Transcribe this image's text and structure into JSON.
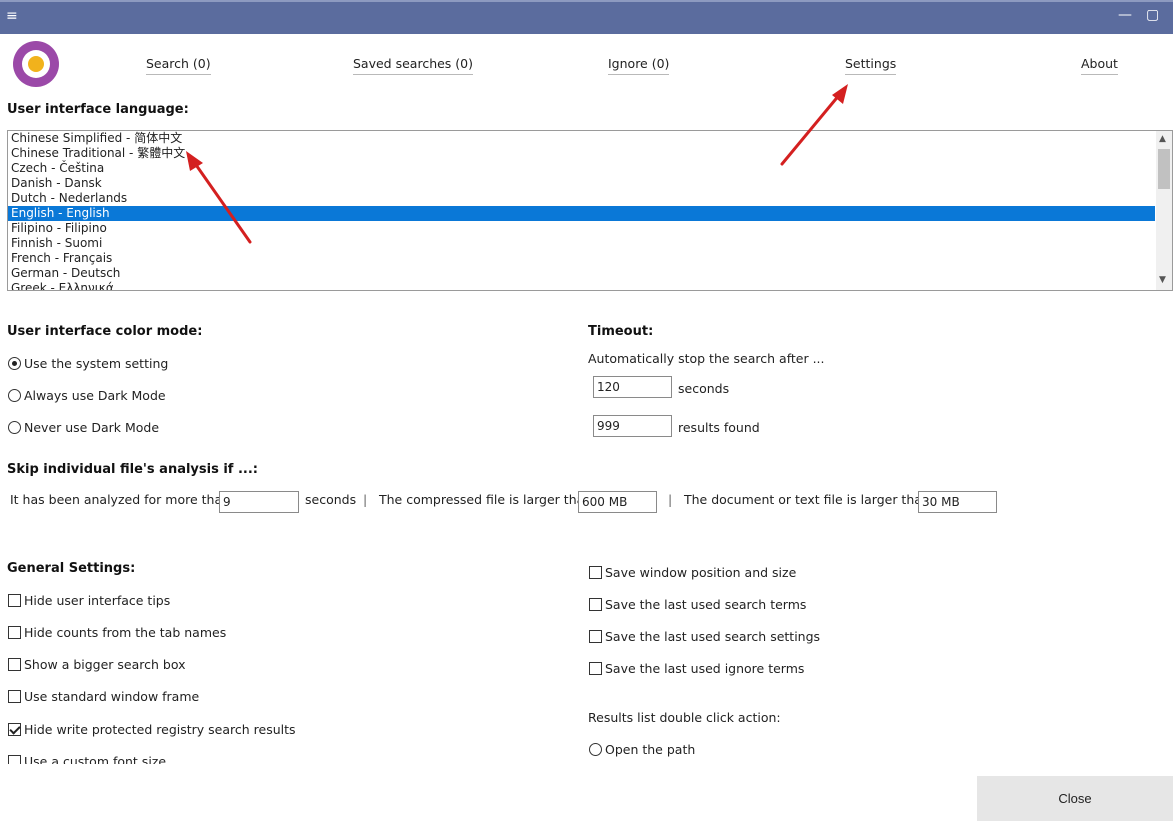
{
  "titlebar": {
    "menu_icon": "hamburger-icon",
    "maximize_icon": "maximize-icon",
    "close_icon": "close-icon"
  },
  "tabs": [
    {
      "label": "Search (0)"
    },
    {
      "label": "Saved searches (0)"
    },
    {
      "label": "Ignore (0)"
    },
    {
      "label": "Settings"
    },
    {
      "label": "About"
    }
  ],
  "language": {
    "heading": "User interface language:",
    "items": [
      "Chinese Simplified - 简体中文",
      "Chinese Traditional - 繁體中文",
      "Czech - Čeština",
      "Danish - Dansk",
      "Dutch - Nederlands",
      "English - English",
      "Filipino - Filipino",
      "Finnish - Suomi",
      "French - Français",
      "German - Deutsch",
      "Greek - Ελληνικά"
    ],
    "selected": "English - English"
  },
  "color_mode": {
    "heading": "User interface color mode:",
    "options": [
      "Use the system setting",
      "Always use Dark Mode",
      "Never use Dark Mode"
    ],
    "selected": "Use the system setting"
  },
  "timeout": {
    "heading": "Timeout:",
    "description": "Automatically stop the search after ...",
    "seconds_value": "120",
    "seconds_label": "seconds",
    "results_value": "999",
    "results_label": "results found"
  },
  "skip": {
    "heading": "Skip individual file's analysis if ...:",
    "analyzed_label": "It has been analyzed for more than",
    "analyzed_value": "9",
    "analyzed_unit": "seconds",
    "separator": "|",
    "compressed_label": "The compressed file is larger than",
    "compressed_value": "600 MB",
    "document_label": "The document or text file is larger than",
    "document_value": "30 MB"
  },
  "general": {
    "heading": "General Settings:",
    "left_options": [
      {
        "label": "Hide user interface tips",
        "checked": false
      },
      {
        "label": "Hide counts from the tab names",
        "checked": false
      },
      {
        "label": "Show a bigger search box",
        "checked": false
      },
      {
        "label": "Use standard window frame",
        "checked": false
      },
      {
        "label": "Hide write protected registry search results",
        "checked": true
      },
      {
        "label": "Use a custom font size",
        "checked": false
      }
    ],
    "right_options": [
      {
        "label": "Save window position and size",
        "checked": false
      },
      {
        "label": "Save the last used search terms",
        "checked": false
      },
      {
        "label": "Save the last used search settings",
        "checked": false
      },
      {
        "label": "Save the last used ignore terms",
        "checked": false
      }
    ],
    "double_click_label": "Results list double click action:",
    "double_click_option": "Open the path"
  },
  "footer": {
    "close_label": "Close"
  },
  "colors": {
    "titlebar": "#5b6c9e",
    "selection": "#0a78d7",
    "annotation_arrow": "#d42020"
  }
}
